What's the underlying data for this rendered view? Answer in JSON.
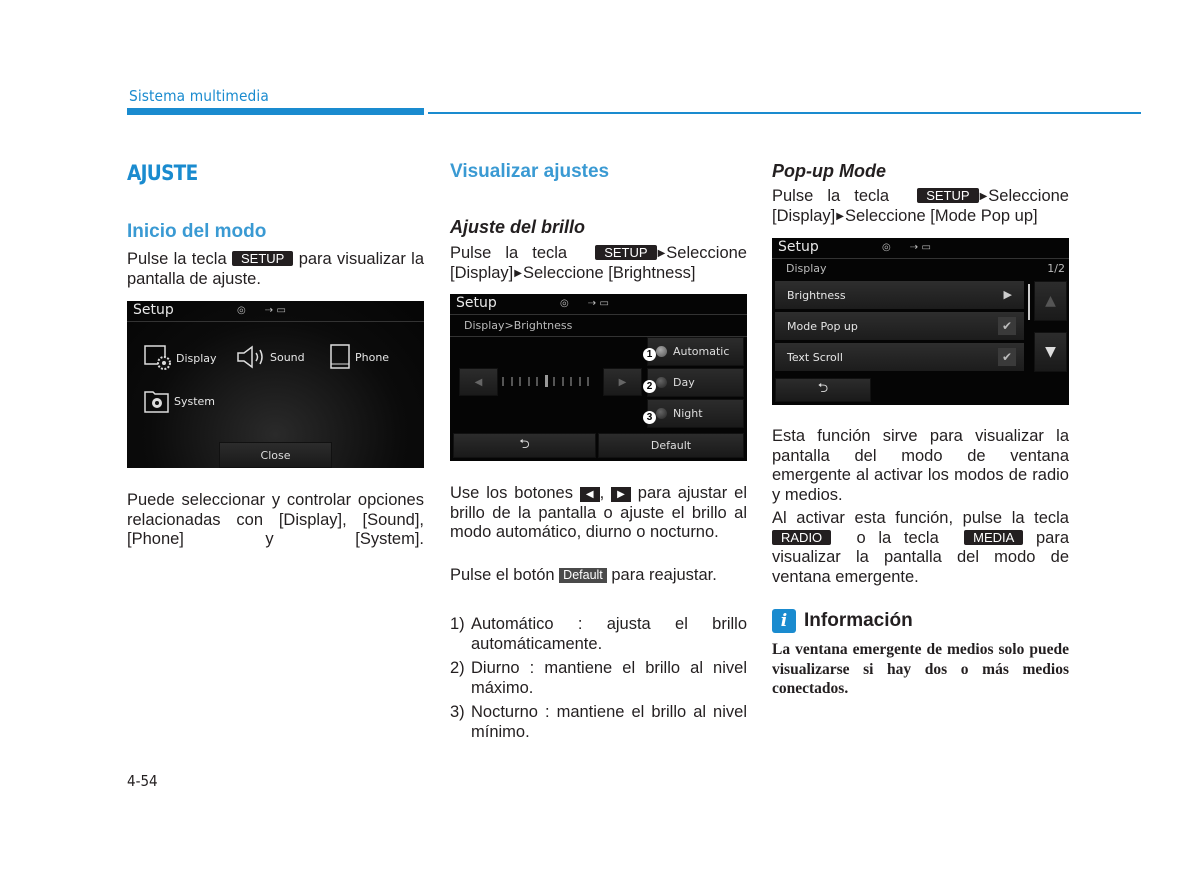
{
  "header": {
    "section_title": "Sistema multimedia",
    "accent_color": "#1a8bcf"
  },
  "page_number": "4-54",
  "column1": {
    "heading": "AJUSTE",
    "subheading": "Inicio del modo",
    "intro": {
      "before": "Pulse la tecla",
      "key": "SETUP",
      "after": "para visualizar la pantalla de ajuste."
    },
    "screen": {
      "title": "Setup",
      "status_icons": [
        "disc-icon",
        "usb-icon",
        "aux-icon"
      ],
      "menu_items": [
        {
          "label": "Display",
          "icon": "display-settings-icon"
        },
        {
          "label": "Sound",
          "icon": "speaker-icon"
        },
        {
          "label": "Phone",
          "icon": "phone-icon"
        },
        {
          "label": "System",
          "icon": "system-folder-icon"
        }
      ],
      "close_label": "Close"
    },
    "description": "Puede seleccionar y controlar opciones relacionadas con [Display], [Sound], [Phone] y [System]."
  },
  "column2": {
    "heading": "Visualizar ajustes",
    "subheading": "Ajuste del brillo",
    "intro": {
      "before": "Pulse la tecla",
      "key": "SETUP",
      "step1": "Seleccione [Display]",
      "step2": "Seleccione [Brightness]"
    },
    "screen": {
      "title": "Setup",
      "breadcrumb": "Display>Brightness",
      "brightness_level": 6,
      "brightness_steps": 11,
      "modes": [
        {
          "number": "1",
          "label": "Automatic"
        },
        {
          "number": "2",
          "label": "Day"
        },
        {
          "number": "3",
          "label": "Night"
        }
      ],
      "back_icon": "back-arrow-icon",
      "default_label": "Default"
    },
    "usage": {
      "before": "Use los botones",
      "sep": ",",
      "after": "para ajustar el brillo de la pantalla o ajuste el brillo al modo automático, diurno o nocturno."
    },
    "reset": {
      "before": "Pulse el botón",
      "key": "Default",
      "after": "para reajustar."
    },
    "list": [
      {
        "num": "1)",
        "text": "Automático : ajusta el brillo automáticamente."
      },
      {
        "num": "2)",
        "text": "Diurno : mantiene el brillo al nivel máximo."
      },
      {
        "num": "3)",
        "text": "Nocturno : mantiene el brillo al nivel mínimo."
      }
    ]
  },
  "column3": {
    "subheading": "Pop-up Mode",
    "intro": {
      "before": "Pulse la tecla",
      "key": "SETUP",
      "step1": "Seleccione [Display]",
      "step2": "Seleccione [Mode Pop up]"
    },
    "screen": {
      "title": "Setup",
      "section": "Display",
      "page_indicator": "1/2",
      "rows": [
        {
          "label": "Brightness",
          "control": "arrow"
        },
        {
          "label": "Mode Pop up",
          "control": "check",
          "checked": true
        },
        {
          "label": "Text Scroll",
          "control": "check",
          "checked": true
        }
      ]
    },
    "para1": "Esta función sirve para visualizar la pantalla del modo de ventana emergente al activar los modos de radio y medios.",
    "para2": {
      "before": "Al activar esta función, pulse la tecla",
      "key1": "RADIO",
      "mid": "o la tecla",
      "key2": "MEDIA",
      "after": "para visualizar la pantalla del modo de ventana emergente."
    },
    "info": {
      "title": "Información",
      "body": "La ventana emergente de medios solo puede visualizarse si hay dos o más medios conectados."
    }
  }
}
